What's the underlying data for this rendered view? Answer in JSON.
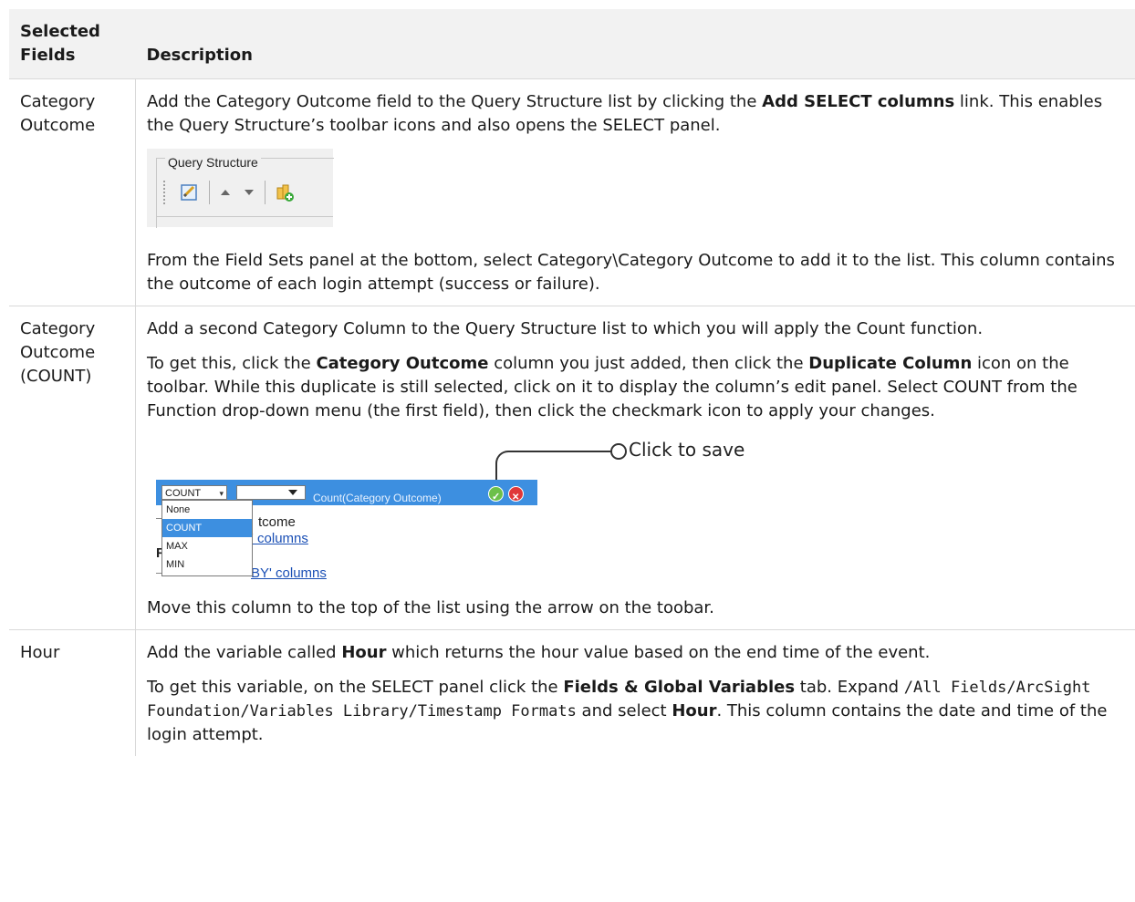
{
  "table": {
    "headers": {
      "selected_fields": "Selected Fields",
      "description": "Description"
    },
    "row1": {
      "field": "Category Outcome",
      "p1_a": "Add the Category Outcome field to the Query Structure list by clicking the ",
      "p1_b": "Add SELECT columns",
      "p1_c": " link. This enables the Query Structure’s toolbar icons and also opens the SELECT panel.",
      "qs_legend": "Query Structure",
      "p2": "From the Field Sets panel at the bottom, select Category\\Category Outcome to add it to the list. This column contains the outcome of each login attempt (success or failure)."
    },
    "row2": {
      "field": "Category Outcome (COUNT)",
      "p1": "Add a second Category Column to the Query Structure list to which you will apply the Count function.",
      "p2_a": "To get this, click the ",
      "p2_b": "Category Outcome",
      "p2_c": " column you just added, then click the ",
      "p2_d": "Duplicate Column",
      "p2_e": " icon on the toolbar. While this duplicate is still selected, click on it to display the column’s edit panel. Select COUNT from the Function drop-down menu (the first field), then click the checkmark icon to apply your changes.",
      "callout": "Click to save",
      "editor": {
        "function_value": "COUNT",
        "expression": "Count(Category Outcome)",
        "options": [
          "None",
          "COUNT",
          "MAX",
          "MIN"
        ],
        "selected_option": "COUNT",
        "bg_text1": "tcome",
        "bg_link1": "' columns",
        "bg_text2": "RO",
        "bg_link2": "BY' columns"
      },
      "p3": "Move this column to the top of the list using the arrow on the toobar."
    },
    "row3": {
      "field": "Hour",
      "p1_a": "Add the variable called ",
      "p1_b": "Hour",
      "p1_c": " which returns the hour value based on the end time of the event.",
      "p2_a": "To get this variable, on the SELECT panel click the ",
      "p2_b": "Fields & Global Variables",
      "p2_c": " tab. Expand ",
      "p2_code": "/All Fields/ArcSight Foundation/Variables Library/Timestamp Formats",
      "p2_d": " and select ",
      "p2_e": "Hour",
      "p2_f": ". This column contains the date and time of the login attempt."
    }
  },
  "colors": {
    "header_bg": "#f2f2f2",
    "editor_bar": "#3d8fe0",
    "border": "#d9d9d9"
  }
}
